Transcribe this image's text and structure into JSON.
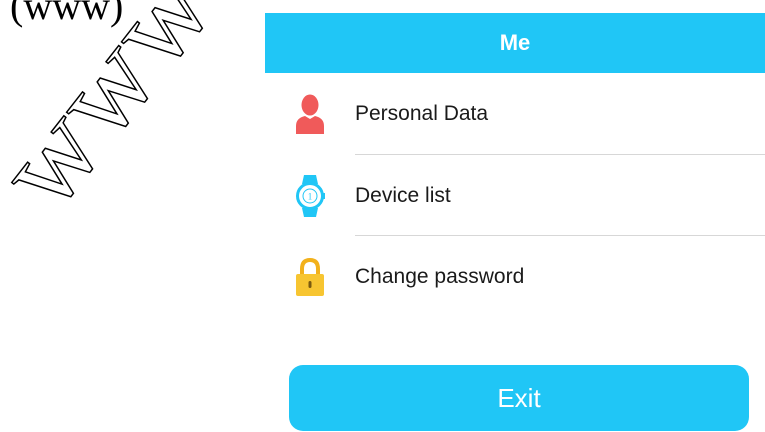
{
  "header": {
    "title": "Me"
  },
  "menu": {
    "items": [
      {
        "label": "Personal Data",
        "icon": "person-icon"
      },
      {
        "label": "Device list",
        "icon": "watch-icon"
      },
      {
        "label": "Change password",
        "icon": "lock-icon"
      }
    ]
  },
  "exit_button": {
    "label": "Exit"
  },
  "background": {
    "doc_text": "(www)",
    "watermark_text": "www"
  },
  "colors": {
    "accent": "#20c6f6",
    "person_icon": "#f05a5a",
    "lock_icon": "#f7c531",
    "divider": "#d7d7d7"
  }
}
